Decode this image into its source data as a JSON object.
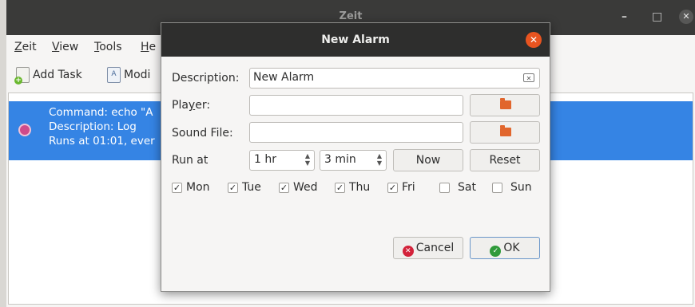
{
  "app": {
    "window_title": "Zeit",
    "menu": [
      {
        "label": "Zeit",
        "mnemonic": "Z",
        "rest": "eit"
      },
      {
        "label": "View",
        "mnemonic": "V",
        "rest": "iew"
      },
      {
        "label": "Tools",
        "mnemonic": "T",
        "rest": "ools"
      },
      {
        "label": "He",
        "mnemonic": "H",
        "rest": "e"
      }
    ],
    "toolbar": {
      "add_task": "Add Task",
      "modify": "Modi"
    },
    "task": {
      "line1": "Command: echo \"A",
      "line2": "Description: Log",
      "line3": "Runs at 01:01, ever"
    }
  },
  "dialog": {
    "title": "New Alarm",
    "description_label": "Description:",
    "description_value": "New Alarm",
    "player_label": "Player:",
    "player_value": "",
    "sound_file_label": "Sound File:",
    "sound_file_value": "",
    "run_at_label": "Run at",
    "hours_value": "1 hr",
    "minutes_value": "3 min",
    "now_label": "Now",
    "reset_label": "Reset",
    "days": [
      {
        "label": "Mon",
        "checked": true
      },
      {
        "label": "Tue",
        "checked": true
      },
      {
        "label": "Wed",
        "checked": true
      },
      {
        "label": "Thu",
        "checked": true
      },
      {
        "label": "Fri",
        "checked": true
      },
      {
        "label": "Sat",
        "checked": false
      },
      {
        "label": "Sun",
        "checked": false
      }
    ],
    "cancel_label": "Cancel",
    "ok_label": "OK"
  },
  "colors": {
    "selection": "#3584e4",
    "title_close": "#e95420",
    "folder": "#e1662d",
    "cancel_icon": "#d3223a",
    "ok_icon": "#2f9a3a"
  }
}
